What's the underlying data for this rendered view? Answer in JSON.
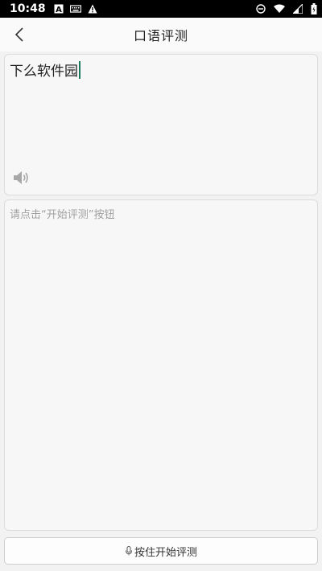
{
  "status_bar": {
    "time": "10:48",
    "left_icons": [
      "text-a-icon",
      "keyboard-icon",
      "warning-icon"
    ],
    "right_icons": [
      "do-not-disturb-icon",
      "wifi-icon",
      "signal-icon",
      "battery-icon"
    ]
  },
  "app_bar": {
    "title": "口语评测",
    "back_icon": "chevron-left-icon"
  },
  "input_panel": {
    "text": "下么软件园",
    "speaker_icon": "speaker-icon"
  },
  "result_panel": {
    "placeholder": "请点击“开始评测”按钮"
  },
  "record_button": {
    "icon": "microphone-icon",
    "label": "按住开始评测"
  }
}
